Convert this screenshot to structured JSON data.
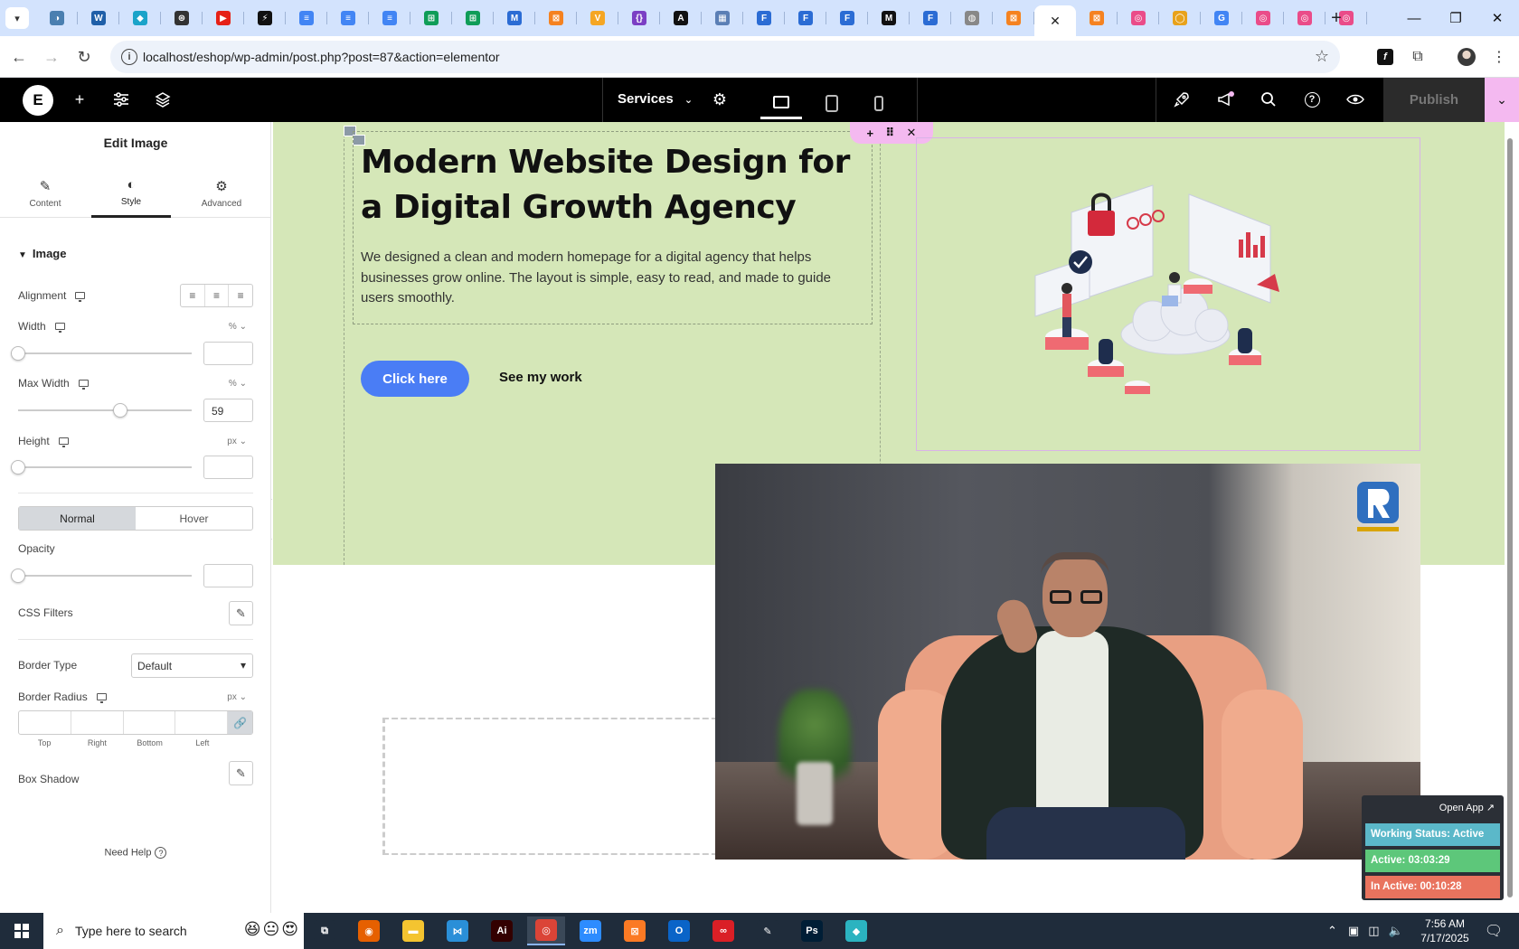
{
  "browser": {
    "tab_dropdown_icon": "chevron-down-icon",
    "active_tab_close": "✕",
    "new_tab": "+",
    "tabs": [
      {
        "color": "#4a7fb0",
        "glyph": "◑"
      },
      {
        "color": "#1f5fa8",
        "glyph": "W"
      },
      {
        "color": "#1aa3c9",
        "glyph": "◆"
      },
      {
        "color": "#333333",
        "glyph": "⊛"
      },
      {
        "color": "#e62117",
        "glyph": "▶"
      },
      {
        "color": "#111111",
        "glyph": "⚡"
      },
      {
        "color": "#4285f4",
        "glyph": "≡"
      },
      {
        "color": "#4285f4",
        "glyph": "≡"
      },
      {
        "color": "#4285f4",
        "glyph": "≡"
      },
      {
        "color": "#0f9d58",
        "glyph": "⊞"
      },
      {
        "color": "#0f9d58",
        "glyph": "⊞"
      },
      {
        "color": "#2b6cd4",
        "glyph": "M"
      },
      {
        "color": "#f58220",
        "glyph": "⊠"
      },
      {
        "color": "#f5a623",
        "glyph": "V"
      },
      {
        "color": "#7b3fc4",
        "glyph": "{}"
      },
      {
        "color": "#111111",
        "glyph": "A"
      },
      {
        "color": "#5b7fb5",
        "glyph": "▦"
      },
      {
        "color": "#2b6cd4",
        "glyph": "F"
      },
      {
        "color": "#2b6cd4",
        "glyph": "F"
      },
      {
        "color": "#2b6cd4",
        "glyph": "F"
      },
      {
        "color": "#111111",
        "glyph": "M"
      },
      {
        "color": "#2b6cd4",
        "glyph": "F"
      },
      {
        "color": "#888888",
        "glyph": "◍"
      },
      {
        "color": "#f58220",
        "glyph": "⊠"
      },
      {
        "color": "active",
        "glyph": "✕"
      },
      {
        "color": "#f58220",
        "glyph": "⊠"
      },
      {
        "color": "#ea4c89",
        "glyph": "◎"
      },
      {
        "color": "#e8a21b",
        "glyph": "◯"
      },
      {
        "color": "#4285f4",
        "glyph": "G"
      },
      {
        "color": "#ea4c89",
        "glyph": "◎"
      },
      {
        "color": "#ea4c89",
        "glyph": "◎"
      },
      {
        "color": "#ea4c89",
        "glyph": "◎"
      }
    ],
    "window_controls": [
      "—",
      "❐",
      "✕"
    ],
    "nav": {
      "back": "←",
      "forward": "→",
      "reload": "↻"
    },
    "url": "localhost/eshop/wp-admin/post.php?post=87&action=elementor",
    "site_info_glyph": "i",
    "bookmark_glyph": "☆"
  },
  "elementor": {
    "logo": "E",
    "page_name": "Services",
    "publish_label": "Publish",
    "colors": {
      "publish_accent": "#f4b9f0",
      "bar": "#000000"
    }
  },
  "panel": {
    "title": "Edit Image",
    "tabs": [
      {
        "label": "Content",
        "icon": "pencil-icon"
      },
      {
        "label": "Style",
        "icon": "half-circle-icon"
      },
      {
        "label": "Advanced",
        "icon": "gear-icon"
      }
    ],
    "section_title": "Image",
    "alignment_label": "Alignment",
    "width_label": "Width",
    "width_unit": "%",
    "width_value": "",
    "max_width_label": "Max Width",
    "max_width_unit": "%",
    "max_width_value": "59",
    "max_width_slider": 0.59,
    "height_label": "Height",
    "height_unit": "px",
    "height_value": "",
    "state_normal": "Normal",
    "state_hover": "Hover",
    "opacity_label": "Opacity",
    "opacity_value": "",
    "css_filters_label": "CSS Filters",
    "border_type_label": "Border Type",
    "border_type_value": "Default",
    "border_radius_label": "Border Radius",
    "border_radius_unit": "px",
    "radius_top": "Top",
    "radius_right": "Right",
    "radius_bottom": "Bottom",
    "radius_left": "Left",
    "box_shadow_label": "Box Shadow",
    "need_help": "Need Help"
  },
  "canvas": {
    "hero_bg": "#d5e7b8",
    "heading": "Modern Website Design for a Digital Growth Agency",
    "description": "We designed a clean and modern homepage for a digital agency that helps businesses grow online. The layout is simple, easy to read, and made to guide users smoothly.",
    "primary_button": "Click here",
    "secondary_link": "See my work",
    "button_color": "#4a7df5"
  },
  "tracker": {
    "open_app": "Open App ↗",
    "working_status": "Working Status: Active",
    "active_time": "Active: 03:03:29",
    "inactive_time": "In Active: 00:10:28",
    "colors": {
      "status": "#5bb8c9",
      "active": "#5dc77a",
      "inactive": "#e9735e"
    }
  },
  "taskbar": {
    "search_placeholder": "Type here to search",
    "apps": [
      {
        "name": "task-view",
        "glyph": "⧉",
        "color": "#1f2c3b"
      },
      {
        "name": "firefox",
        "glyph": "◉",
        "color": "#e66000"
      },
      {
        "name": "file-explorer",
        "glyph": "▬",
        "color": "#f4c430"
      },
      {
        "name": "vscode",
        "glyph": "⋈",
        "color": "#2a8fd8"
      },
      {
        "name": "illustrator",
        "glyph": "Ai",
        "color": "#330000"
      },
      {
        "name": "chrome",
        "glyph": "◎",
        "color": "#db4437"
      },
      {
        "name": "zoom",
        "glyph": "zm",
        "color": "#2d8cff"
      },
      {
        "name": "xampp",
        "glyph": "⊠",
        "color": "#fb7a24"
      },
      {
        "name": "outlook",
        "glyph": "O",
        "color": "#0a64c8"
      },
      {
        "name": "creative-cloud",
        "glyph": "∞",
        "color": "#da1f26"
      },
      {
        "name": "inkscape",
        "glyph": "✎",
        "color": "#1f2c3b"
      },
      {
        "name": "photoshop",
        "glyph": "Ps",
        "color": "#001e36"
      },
      {
        "name": "app-diamond",
        "glyph": "◆",
        "color": "#2bb3c0"
      }
    ],
    "time": "7:56 AM",
    "date": "7/17/2025"
  }
}
